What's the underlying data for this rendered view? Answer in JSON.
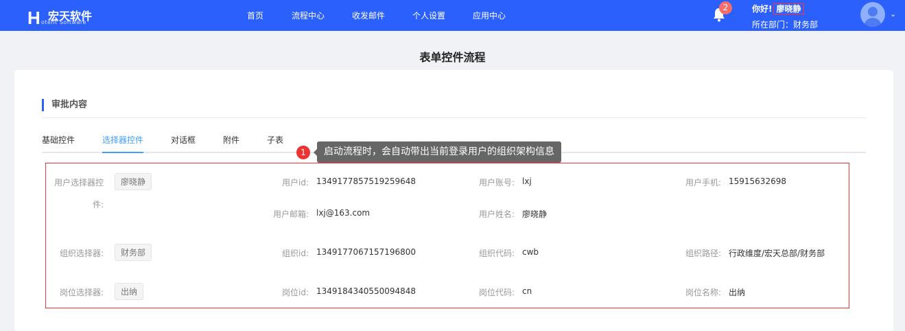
{
  "header": {
    "logo": {
      "mark": "H",
      "name": "宏天软件",
      "sub": "otent Software"
    },
    "nav": [
      "首页",
      "流程中心",
      "收发邮件",
      "个人设置",
      "应用中心"
    ],
    "notifications": 2,
    "greeting": "你好!",
    "user_name": "廖晓静",
    "dept_label": "所在部门：财务部"
  },
  "page_title": "表单控件流程",
  "section_title": "审批内容",
  "tabs": [
    "基础控件",
    "选择器控件",
    "对话框",
    "附件",
    "子表"
  ],
  "active_tab": "选择器控件",
  "tooltip": {
    "number": "1",
    "text": "启动流程时，会自动带出当前登录用户的组织架构信息"
  },
  "fields": {
    "user_selector": {
      "label": "用户选择器控",
      "label2": "件:",
      "value": "廖晓静"
    },
    "user_id": {
      "label": "用户id:",
      "value": "1349177857519259648"
    },
    "user_account": {
      "label": "用户账号:",
      "value": "lxj"
    },
    "user_phone": {
      "label": "用户手机:",
      "value": "15915632698"
    },
    "user_email": {
      "label": "用户邮箱:",
      "value": "lxj@163.com"
    },
    "user_name": {
      "label": "用户姓名:",
      "value": "廖晓静"
    },
    "org_selector": {
      "label": "组织选择器:",
      "value": "财务部"
    },
    "org_id": {
      "label": "组织id:",
      "value": "1349177067157196800"
    },
    "org_code": {
      "label": "组织代码:",
      "value": "cwb"
    },
    "org_path": {
      "label": "组织路径:",
      "value": "行政维度/宏天总部/财务部"
    },
    "post_selector": {
      "label": "岗位选择器:",
      "value": "出纳"
    },
    "post_id": {
      "label": "岗位id:",
      "value": "1349184340550094848"
    },
    "post_code": {
      "label": "岗位代码:",
      "value": "cn"
    },
    "post_name": {
      "label": "岗位名称:",
      "value": "出纳"
    }
  }
}
